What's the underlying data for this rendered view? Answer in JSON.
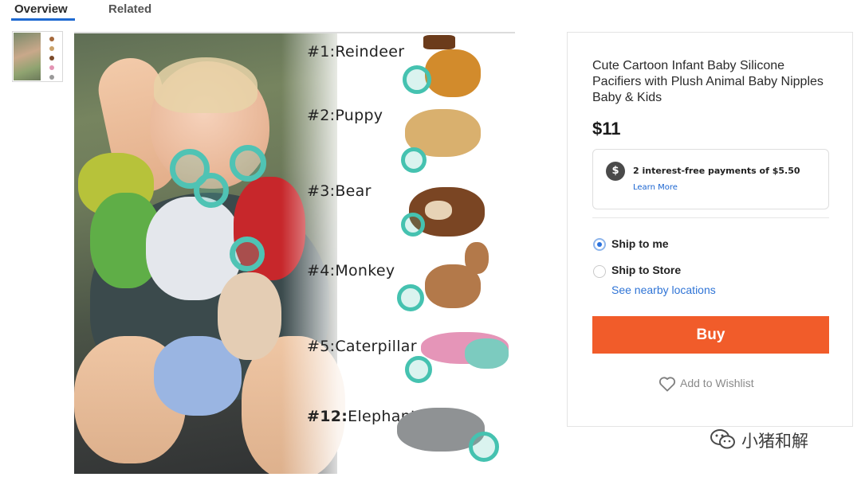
{
  "tabs": {
    "overview": "Overview",
    "related": "Related",
    "active_color": "#1e6ad1"
  },
  "image": {
    "labels": [
      {
        "num": "#1:",
        "name": "Reindeer"
      },
      {
        "num": "#2:",
        "name": "Puppy"
      },
      {
        "num": "#3:",
        "name": "Bear"
      },
      {
        "num": "#4:",
        "name": "Monkey"
      },
      {
        "num": "#5:",
        "name": "Caterpillar"
      },
      {
        "num": "#12:",
        "name": "Elephant"
      }
    ]
  },
  "product": {
    "title": "Cute Cartoon Infant Baby Silicone Pacifiers with Plush Animal Baby Nipples Baby & Kids",
    "price": "$11",
    "payment": {
      "icon": "dollar-icon",
      "icon_glyph": "$",
      "text": "2 interest-free payments of $5.50",
      "learn_more": "Learn More"
    },
    "shipping": {
      "ship_to_me": "Ship to me",
      "ship_to_store": "Ship to Store",
      "selected": "ship_to_me",
      "nearby": "See nearby locations"
    },
    "buy_label": "Buy",
    "buy_color": "#f15c2a",
    "wishlist_label": "Add to Wishlist",
    "wishlist_icon": "heart-icon"
  },
  "watermark": {
    "text": "小猪和解",
    "icon": "wechat-icon"
  }
}
